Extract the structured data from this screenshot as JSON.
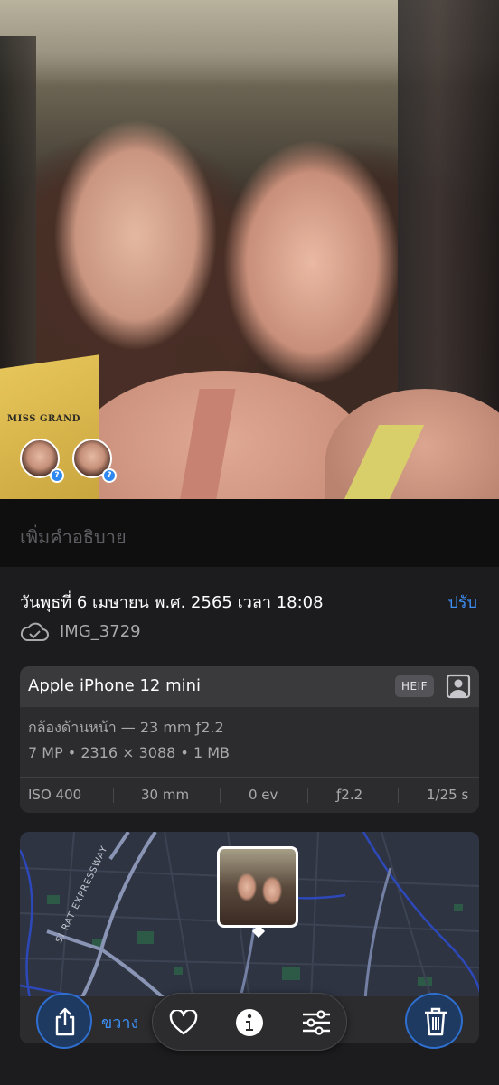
{
  "photo": {
    "sash_text": "MISS GRAND",
    "face_tag_badge": "?"
  },
  "caption": {
    "placeholder": "เพิ่มคำอธิบาย"
  },
  "info": {
    "date": "วันพุธที่ 6 เมษายน พ.ศ. 2565 เวลา 18:08",
    "adjust_label": "ปรับ",
    "filename": "IMG_3729"
  },
  "camera": {
    "device": "Apple iPhone 12 mini",
    "format": "HEIF",
    "lens": "กล้องด้านหน้า — 23 mm ƒ2.2",
    "specs": "7 MP • 2316 × 3088 • 1 MB",
    "exif": [
      "ISO 400",
      "30 mm",
      "0 ev",
      "ƒ2.2",
      "1/25 s"
    ]
  },
  "map": {
    "road_label": "SI RAT EXPRESSWAY",
    "footer_text": "ขวาง"
  },
  "toolbar": {
    "icons": [
      "share-icon",
      "heart-icon",
      "info-icon",
      "adjust-icon",
      "trash-icon"
    ]
  }
}
